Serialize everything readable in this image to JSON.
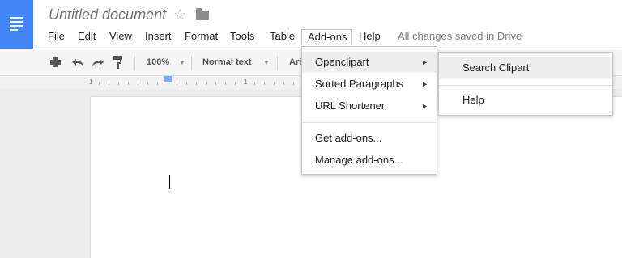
{
  "document": {
    "title": "Untitled document",
    "star_icon": "star-icon",
    "folder_icon": "folder-icon"
  },
  "menubar": {
    "items": [
      {
        "label": "File"
      },
      {
        "label": "Edit"
      },
      {
        "label": "View"
      },
      {
        "label": "Insert"
      },
      {
        "label": "Format"
      },
      {
        "label": "Tools"
      },
      {
        "label": "Table"
      },
      {
        "label": "Add-ons"
      },
      {
        "label": "Help"
      }
    ],
    "active_item": "Add-ons",
    "save_status": "All changes saved in Drive"
  },
  "toolbar": {
    "icons": [
      "print-icon",
      "undo-icon",
      "redo-icon",
      "paint-format-icon"
    ],
    "zoom": "100%",
    "style": "Normal text",
    "font_partial": "Ari"
  },
  "ruler": {
    "labels": [
      "1",
      "1"
    ]
  },
  "addons_menu": {
    "items": [
      {
        "label": "Openclipart",
        "has_submenu": true
      },
      {
        "label": "Sorted Paragraphs",
        "has_submenu": true
      },
      {
        "label": "URL Shortener",
        "has_submenu": true
      },
      {
        "label": "Get add-ons..."
      },
      {
        "label": "Manage add-ons..."
      }
    ],
    "highlighted": "Openclipart"
  },
  "openclipart_submenu": {
    "items": [
      {
        "label": "Search Clipart"
      },
      {
        "label": "Help"
      }
    ],
    "highlighted": "Search Clipart"
  },
  "colors": {
    "logo_blue": "#4285f4",
    "menu_highlight": "#eeeeee"
  }
}
